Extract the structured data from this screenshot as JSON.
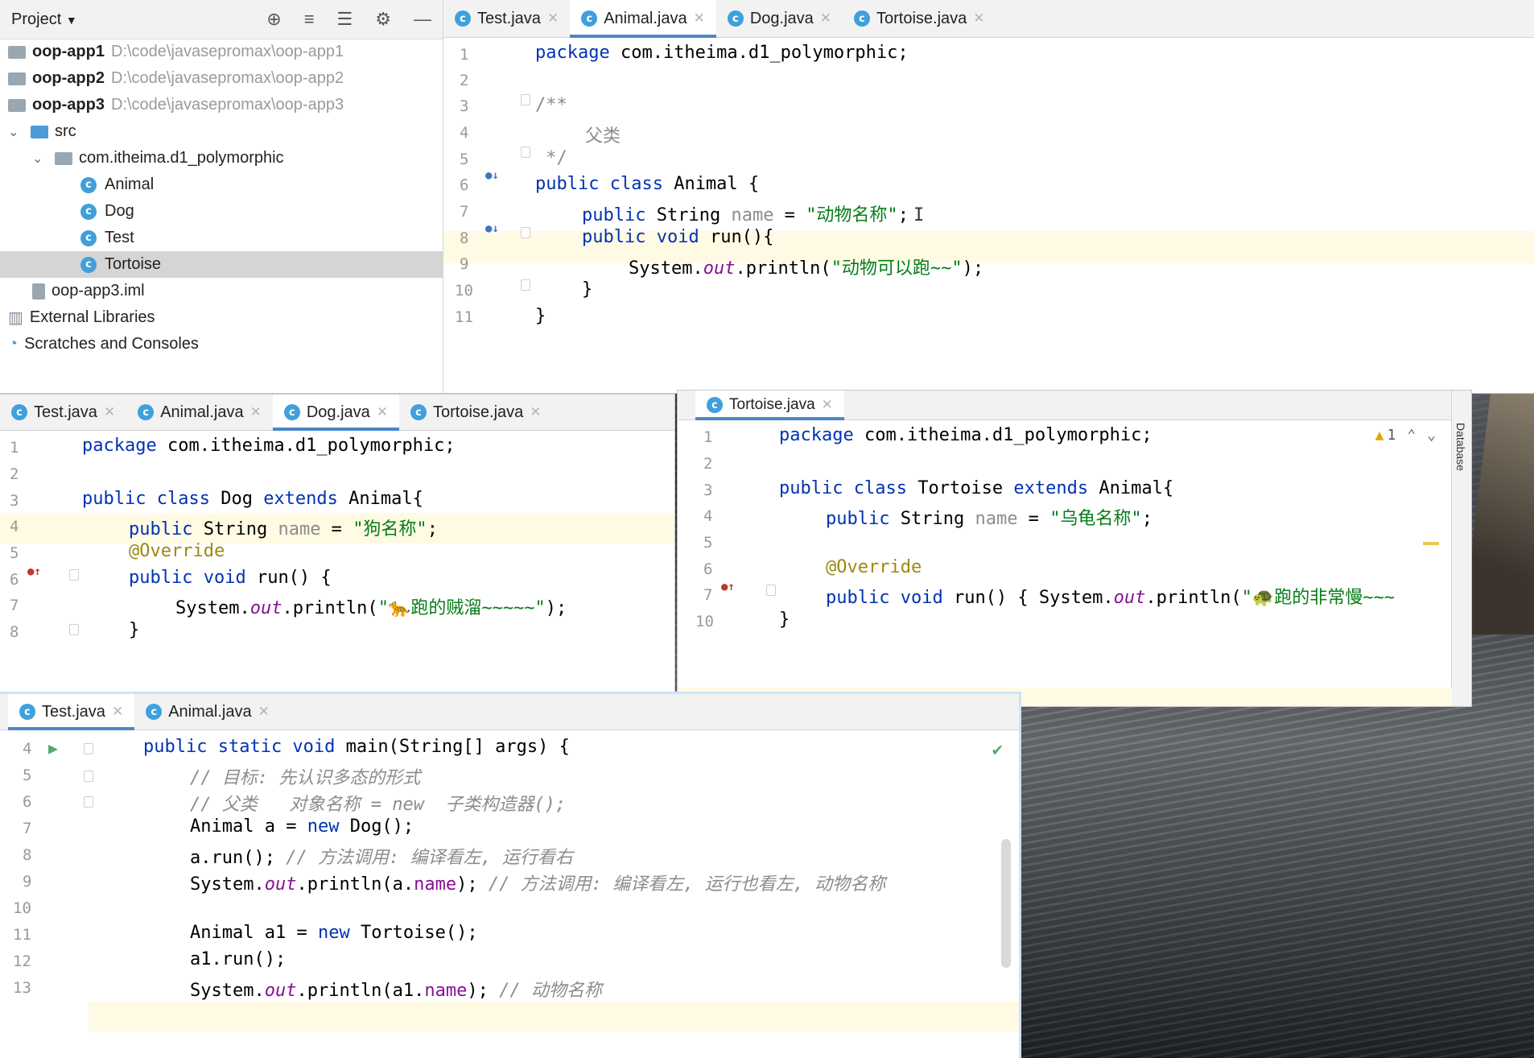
{
  "project_panel": {
    "title": "Project",
    "tree": [
      {
        "label": "oop-app1",
        "path": "D:\\code\\javasepromax\\oop-app1",
        "kind": "module"
      },
      {
        "label": "oop-app2",
        "path": "D:\\code\\javasepromax\\oop-app2",
        "kind": "module"
      },
      {
        "label": "oop-app3",
        "path": "D:\\code\\javasepromax\\oop-app3",
        "kind": "module"
      },
      {
        "label": "src",
        "kind": "folder"
      },
      {
        "label": "com.itheima.d1_polymorphic",
        "kind": "package"
      },
      {
        "label": "Animal",
        "kind": "class"
      },
      {
        "label": "Dog",
        "kind": "class"
      },
      {
        "label": "Test",
        "kind": "class"
      },
      {
        "label": "Tortoise",
        "kind": "class"
      },
      {
        "label": "oop-app3.iml",
        "kind": "file"
      },
      {
        "label": "External Libraries",
        "kind": "lib"
      },
      {
        "label": "Scratches and Consoles",
        "kind": "scratch"
      }
    ]
  },
  "editor_top": {
    "tabs": [
      "Test.java",
      "Animal.java",
      "Dog.java",
      "Tortoise.java"
    ],
    "active_tab": "Animal.java",
    "line_numbers": [
      "1",
      "2",
      "3",
      "4",
      "5",
      "6",
      "7",
      "8",
      "9",
      "10",
      "11"
    ],
    "code": {
      "l1a": "package",
      "l1b": " com.itheima.d1_polymorphic;",
      "l3": "/**",
      "l4": "父类",
      "l5": " */",
      "l6a": "public class",
      "l6b": " Animal {",
      "l7a": "public",
      "l7b": " String ",
      "l7c": "name",
      "l7d": " = ",
      "l7e": "\"动物名称\"",
      "l7f": ";",
      "l8a": "public void",
      "l8b": " run(){",
      "l9a": "System.",
      "l9b": "out",
      "l9c": ".println(",
      "l9d": "\"动物可以跑~~\"",
      "l9e": ");",
      "l10": "}",
      "l11": "}"
    }
  },
  "editor_dog": {
    "tabs": [
      "Test.java",
      "Animal.java",
      "Dog.java",
      "Tortoise.java"
    ],
    "active_tab": "Dog.java",
    "line_numbers": [
      "1",
      "2",
      "3",
      "4",
      "5",
      "6",
      "7",
      "8"
    ],
    "code": {
      "l1a": "package",
      "l1b": " com.itheima.d1_polymorphic;",
      "l3a": "public class",
      "l3b": " Dog ",
      "l3c": "extends",
      "l3d": " Animal{",
      "l4a": "public",
      "l4b": " String ",
      "l4c": "name",
      "l4d": " = ",
      "l4e": "\"狗名称\"",
      "l4f": ";",
      "l5": "@Override",
      "l6a": "public void",
      "l6b": " run() {",
      "l7a": "System.",
      "l7b": "out",
      "l7c": ".println(",
      "l7d": "\"🐆跑的贼溜~~~~~\"",
      "l7e": ");",
      "l8": "}"
    }
  },
  "editor_tortoise": {
    "tabs": [
      "Tortoise.java"
    ],
    "active_tab": "Tortoise.java",
    "warnings": "1",
    "side_label": "Database",
    "line_numbers": [
      "1",
      "2",
      "3",
      "4",
      "5",
      "6",
      "7",
      "10"
    ],
    "code": {
      "l1a": "package",
      "l1b": " com.itheima.d1_polymorphic;",
      "l3a": "public class",
      "l3b": " Tortoise ",
      "l3c": "extends",
      "l3d": " Animal{",
      "l4a": "public",
      "l4b": " String ",
      "l4c": "name",
      "l4d": " = ",
      "l4e": "\"乌龟名称\"",
      "l4f": ";",
      "l6": "@Override",
      "l7a": "public void",
      "l7b": " run() { ",
      "l7c": "System.",
      "l7d": "out",
      "l7e": ".println(",
      "l7f": "\"🐢跑的非常慢~~~",
      "l10": "}"
    }
  },
  "editor_test": {
    "tabs": [
      "Test.java",
      "Animal.java"
    ],
    "active_tab": "Test.java",
    "line_numbers": [
      "4",
      "5",
      "6",
      "7",
      "8",
      "9",
      "10",
      "11",
      "12",
      "13"
    ],
    "code": {
      "l4a": "public static void",
      "l4b": " main(String[] args) {",
      "l5": "// 目标: 先认识多态的形式",
      "l6": "// 父类   对象名称 = new  子类构造器();",
      "l7a": "Animal a = ",
      "l7b": "new",
      "l7c": " Dog();",
      "l8a": "a.run(); ",
      "l8b": "// 方法调用: 编译看左, 运行看右",
      "l9a": "System.",
      "l9b": "out",
      "l9c": ".println(a.",
      "l9d": "name",
      "l9e": "); ",
      "l9f": "// 方法调用: 编译看左, 运行也看左, 动物名称",
      "l11a": "Animal a1 = ",
      "l11b": "new",
      "l11c": " Tortoise();",
      "l12": "a1.run();",
      "l13a": "System.",
      "l13b": "out",
      "l13c": ".println(a1.",
      "l13d": "name",
      "l13e": "); ",
      "l13f": "// 动物名称"
    }
  },
  "colors": {
    "keyword": "#0033b3",
    "string": "#067d17",
    "field": "#871094",
    "annotation": "#9e880d",
    "comment": "#8c8c8c",
    "tab_underline": "#4a88c7"
  }
}
